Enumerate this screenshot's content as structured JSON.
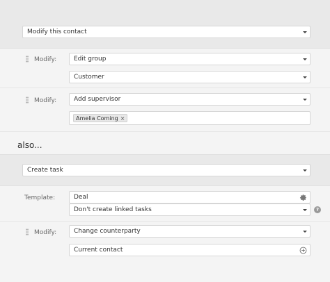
{
  "action1": {
    "select_value": "Modify this contact",
    "modify1": {
      "label": "Modify:",
      "field_value": "Edit group",
      "group_value": "Customer"
    },
    "modify2": {
      "label": "Modify:",
      "field_value": "Add supervisor",
      "tags": [
        "Amelia Coming"
      ]
    }
  },
  "also_label": "also...",
  "action2": {
    "select_value": "Create task",
    "template": {
      "label": "Template:",
      "value": "Deal",
      "linked_value": "Don't create linked tasks"
    },
    "modify3": {
      "label": "Modify:",
      "field_value": "Change counterparty",
      "value": "Current contact"
    }
  },
  "icons": {
    "gear": "gear-icon",
    "plus": "plus-circle-icon",
    "help": "help-icon",
    "remove": "×",
    "help_glyph": "?"
  }
}
